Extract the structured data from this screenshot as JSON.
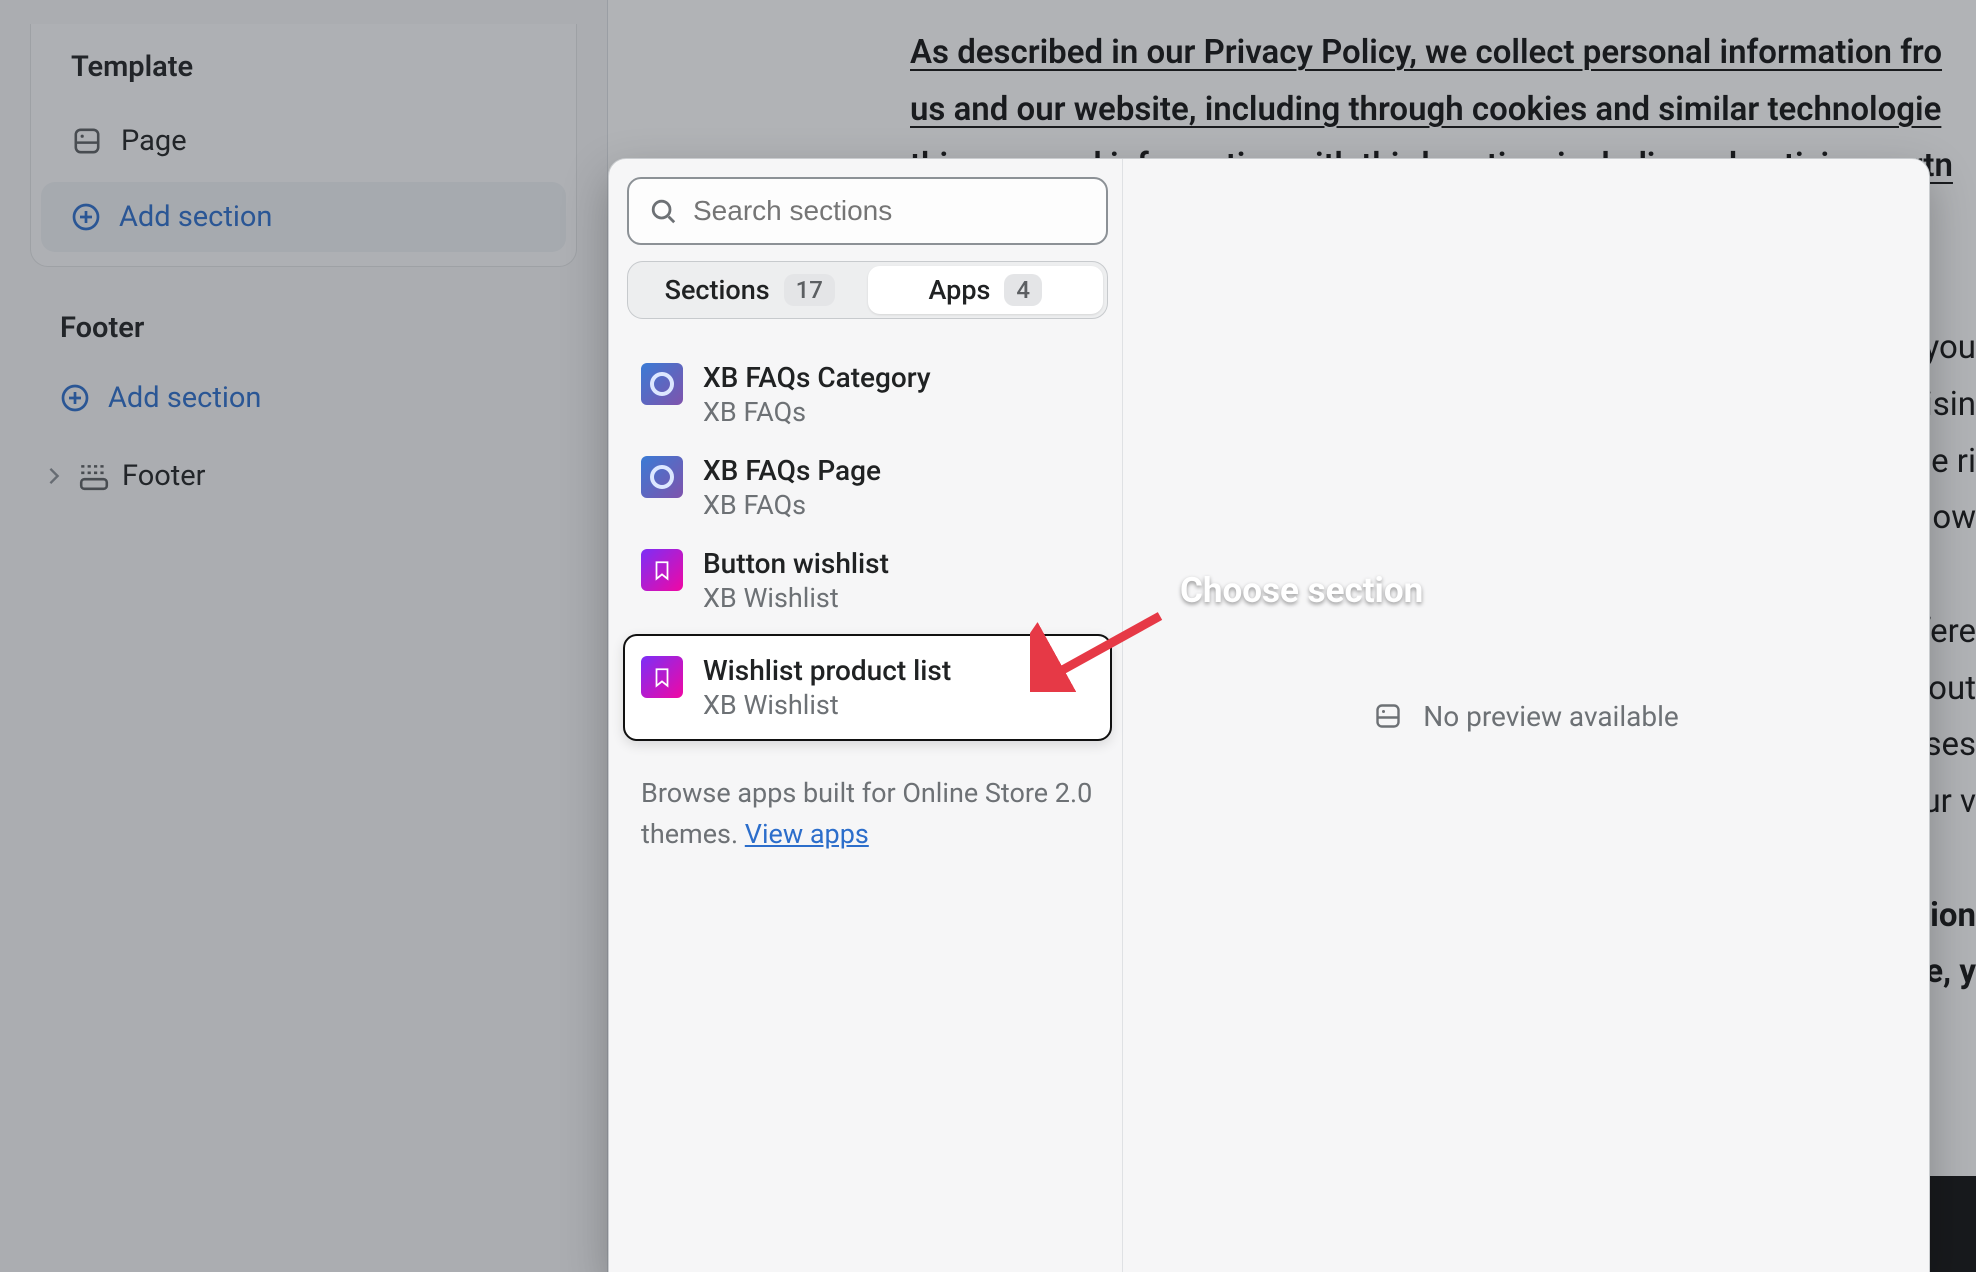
{
  "sidebar": {
    "template_title": "Template",
    "page_label": "Page",
    "add_section_label": "Add section",
    "footer_title": "Footer",
    "footer_add_section_label": "Add section",
    "footer_item_label": "Footer"
  },
  "policy": {
    "top_block": "As described in our Privacy Policy, we collect personal information fro\nus and our website, including through cookies and similar technologie\nthis personal information with third parties, including advertising partn\ninte",
    "rest_lines": [
      "you",
      "tisin",
      "ne ri",
      "llow",
      "",
      "fere",
      "-out",
      "ses",
      "ur v",
      "",
      "ation",
      "e, y"
    ]
  },
  "popover": {
    "search_placeholder": "Search sections",
    "tabs": {
      "sections_label": "Sections",
      "sections_count": "17",
      "apps_label": "Apps",
      "apps_count": "4"
    },
    "items": [
      {
        "name": "XB FAQs Category",
        "sub": "XB FAQs",
        "icon": "faq"
      },
      {
        "name": "XB FAQs Page",
        "sub": "XB FAQs",
        "icon": "faq"
      },
      {
        "name": "Button wishlist",
        "sub": "XB Wishlist",
        "icon": "wish"
      },
      {
        "name": "Wishlist product list",
        "sub": "XB Wishlist",
        "icon": "wish",
        "highlight": true
      }
    ],
    "helper_text": "Browse apps built for Online Store 2.0 themes. ",
    "helper_link": "View apps",
    "right_title": "Choose section",
    "no_preview_label": "No preview available"
  }
}
